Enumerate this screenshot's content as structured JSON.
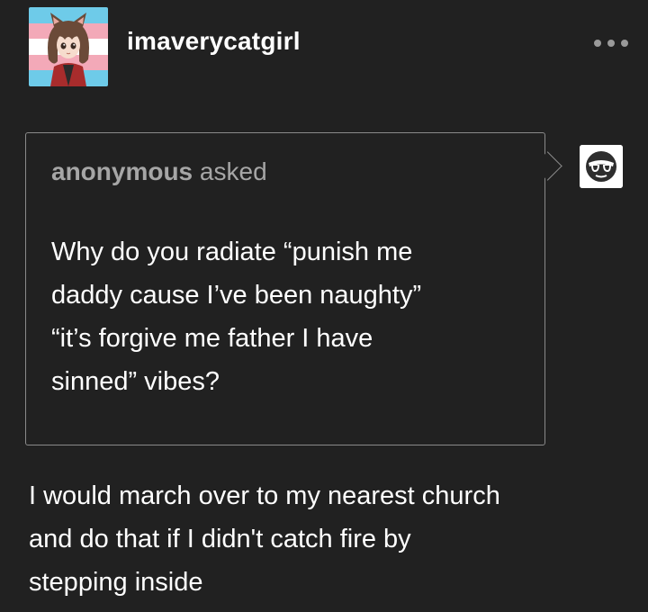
{
  "post": {
    "username": "imaverycatgirl",
    "avatar_icon": "catgirl-avatar-icon",
    "more_icon": "more-options-icon"
  },
  "ask": {
    "asker": "anonymous",
    "asked_label": " asked",
    "question_lines": [
      "Why do you radiate “punish me",
      "daddy cause I’ve been naughty”",
      "“it’s forgive me father I have",
      "sinned” vibes?"
    ],
    "anon_avatar_icon": "sunglasses-face-icon"
  },
  "answer": {
    "lines": [
      "I would march over to my nearest church",
      "and do that if I didn't catch fire by",
      "stepping inside"
    ]
  },
  "colors": {
    "background": "#212121",
    "text": "#ffffff",
    "muted": "#a6a6a6",
    "border": "#8a8a8a",
    "flag_blue": "#6ecbe9",
    "flag_pink": "#f3a9b8"
  }
}
